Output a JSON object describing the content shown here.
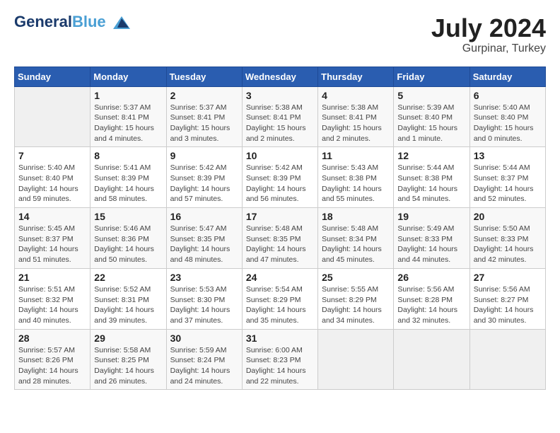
{
  "header": {
    "logo_general": "General",
    "logo_blue": "Blue",
    "month": "July 2024",
    "location": "Gurpinar, Turkey"
  },
  "days_of_week": [
    "Sunday",
    "Monday",
    "Tuesday",
    "Wednesday",
    "Thursday",
    "Friday",
    "Saturday"
  ],
  "weeks": [
    [
      {
        "day": "",
        "info": ""
      },
      {
        "day": "1",
        "info": "Sunrise: 5:37 AM\nSunset: 8:41 PM\nDaylight: 15 hours\nand 4 minutes."
      },
      {
        "day": "2",
        "info": "Sunrise: 5:37 AM\nSunset: 8:41 PM\nDaylight: 15 hours\nand 3 minutes."
      },
      {
        "day": "3",
        "info": "Sunrise: 5:38 AM\nSunset: 8:41 PM\nDaylight: 15 hours\nand 2 minutes."
      },
      {
        "day": "4",
        "info": "Sunrise: 5:38 AM\nSunset: 8:41 PM\nDaylight: 15 hours\nand 2 minutes."
      },
      {
        "day": "5",
        "info": "Sunrise: 5:39 AM\nSunset: 8:40 PM\nDaylight: 15 hours\nand 1 minute."
      },
      {
        "day": "6",
        "info": "Sunrise: 5:40 AM\nSunset: 8:40 PM\nDaylight: 15 hours\nand 0 minutes."
      }
    ],
    [
      {
        "day": "7",
        "info": "Sunrise: 5:40 AM\nSunset: 8:40 PM\nDaylight: 14 hours\nand 59 minutes."
      },
      {
        "day": "8",
        "info": "Sunrise: 5:41 AM\nSunset: 8:39 PM\nDaylight: 14 hours\nand 58 minutes."
      },
      {
        "day": "9",
        "info": "Sunrise: 5:42 AM\nSunset: 8:39 PM\nDaylight: 14 hours\nand 57 minutes."
      },
      {
        "day": "10",
        "info": "Sunrise: 5:42 AM\nSunset: 8:39 PM\nDaylight: 14 hours\nand 56 minutes."
      },
      {
        "day": "11",
        "info": "Sunrise: 5:43 AM\nSunset: 8:38 PM\nDaylight: 14 hours\nand 55 minutes."
      },
      {
        "day": "12",
        "info": "Sunrise: 5:44 AM\nSunset: 8:38 PM\nDaylight: 14 hours\nand 54 minutes."
      },
      {
        "day": "13",
        "info": "Sunrise: 5:44 AM\nSunset: 8:37 PM\nDaylight: 14 hours\nand 52 minutes."
      }
    ],
    [
      {
        "day": "14",
        "info": "Sunrise: 5:45 AM\nSunset: 8:37 PM\nDaylight: 14 hours\nand 51 minutes."
      },
      {
        "day": "15",
        "info": "Sunrise: 5:46 AM\nSunset: 8:36 PM\nDaylight: 14 hours\nand 50 minutes."
      },
      {
        "day": "16",
        "info": "Sunrise: 5:47 AM\nSunset: 8:35 PM\nDaylight: 14 hours\nand 48 minutes."
      },
      {
        "day": "17",
        "info": "Sunrise: 5:48 AM\nSunset: 8:35 PM\nDaylight: 14 hours\nand 47 minutes."
      },
      {
        "day": "18",
        "info": "Sunrise: 5:48 AM\nSunset: 8:34 PM\nDaylight: 14 hours\nand 45 minutes."
      },
      {
        "day": "19",
        "info": "Sunrise: 5:49 AM\nSunset: 8:33 PM\nDaylight: 14 hours\nand 44 minutes."
      },
      {
        "day": "20",
        "info": "Sunrise: 5:50 AM\nSunset: 8:33 PM\nDaylight: 14 hours\nand 42 minutes."
      }
    ],
    [
      {
        "day": "21",
        "info": "Sunrise: 5:51 AM\nSunset: 8:32 PM\nDaylight: 14 hours\nand 40 minutes."
      },
      {
        "day": "22",
        "info": "Sunrise: 5:52 AM\nSunset: 8:31 PM\nDaylight: 14 hours\nand 39 minutes."
      },
      {
        "day": "23",
        "info": "Sunrise: 5:53 AM\nSunset: 8:30 PM\nDaylight: 14 hours\nand 37 minutes."
      },
      {
        "day": "24",
        "info": "Sunrise: 5:54 AM\nSunset: 8:29 PM\nDaylight: 14 hours\nand 35 minutes."
      },
      {
        "day": "25",
        "info": "Sunrise: 5:55 AM\nSunset: 8:29 PM\nDaylight: 14 hours\nand 34 minutes."
      },
      {
        "day": "26",
        "info": "Sunrise: 5:56 AM\nSunset: 8:28 PM\nDaylight: 14 hours\nand 32 minutes."
      },
      {
        "day": "27",
        "info": "Sunrise: 5:56 AM\nSunset: 8:27 PM\nDaylight: 14 hours\nand 30 minutes."
      }
    ],
    [
      {
        "day": "28",
        "info": "Sunrise: 5:57 AM\nSunset: 8:26 PM\nDaylight: 14 hours\nand 28 minutes."
      },
      {
        "day": "29",
        "info": "Sunrise: 5:58 AM\nSunset: 8:25 PM\nDaylight: 14 hours\nand 26 minutes."
      },
      {
        "day": "30",
        "info": "Sunrise: 5:59 AM\nSunset: 8:24 PM\nDaylight: 14 hours\nand 24 minutes."
      },
      {
        "day": "31",
        "info": "Sunrise: 6:00 AM\nSunset: 8:23 PM\nDaylight: 14 hours\nand 22 minutes."
      },
      {
        "day": "",
        "info": ""
      },
      {
        "day": "",
        "info": ""
      },
      {
        "day": "",
        "info": ""
      }
    ]
  ]
}
